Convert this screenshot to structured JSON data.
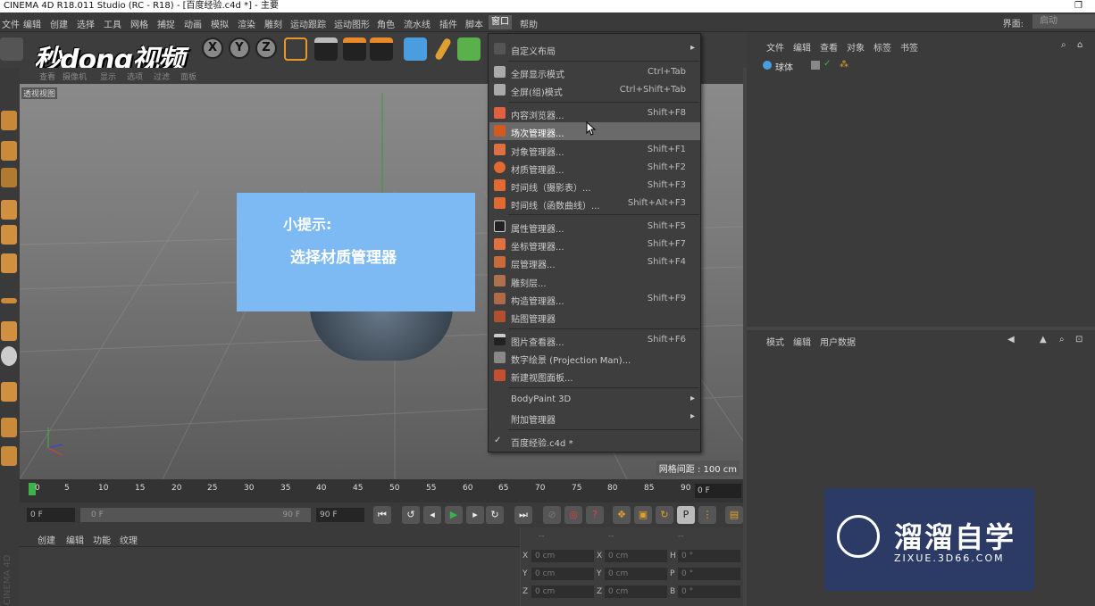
{
  "titlebar": {
    "title": "CINEMA 4D R18.011 Studio (RC - R18) - [百度经验.c4d *] - 主要"
  },
  "menubar": {
    "items": [
      "文件",
      "编辑",
      "创建",
      "选择",
      "工具",
      "网格",
      "捕捉",
      "动画",
      "模拟",
      "渲染",
      "雕刻",
      "运动跟踪",
      "运动图形",
      "角色",
      "流水线",
      "插件",
      "脚本",
      "窗口",
      "帮助"
    ],
    "interface_label": "界面:",
    "interface_value": "启动"
  },
  "watermark": {
    "logo_text": "秒dong视频"
  },
  "toolbar": {
    "axes": [
      "X",
      "Y",
      "Z"
    ]
  },
  "viewport": {
    "menu": [
      "查看",
      "摄像机",
      "显示",
      "选项",
      "过滤",
      "面板"
    ],
    "tag": "透视视图",
    "grid_info": "网格间距 : 100 cm"
  },
  "tip": {
    "line1": "小提示:",
    "line2": "选择材质管理器"
  },
  "timeline": {
    "ticks": [
      "0",
      "5",
      "10",
      "15",
      "20",
      "25",
      "30",
      "35",
      "40",
      "45",
      "50",
      "55",
      "60",
      "65",
      "70",
      "75",
      "80",
      "85",
      "90"
    ],
    "frame": "0 F"
  },
  "controls": {
    "start": "0 F",
    "range_start": "0 F",
    "range_end": "90 F",
    "end": "90 F"
  },
  "material_panel": {
    "menu": [
      "创建",
      "编辑",
      "功能",
      "纹理"
    ]
  },
  "coord_panel": {
    "header": [
      "--",
      "--",
      "--"
    ],
    "rows": [
      {
        "a": "X",
        "av": "0 cm",
        "b": "X",
        "bv": "0 cm",
        "c": "H",
        "cv": "0 °"
      },
      {
        "a": "Y",
        "av": "0 cm",
        "b": "Y",
        "bv": "0 cm",
        "c": "P",
        "cv": "0 °"
      },
      {
        "a": "Z",
        "av": "0 cm",
        "b": "Z",
        "bv": "0 cm",
        "c": "B",
        "cv": "0 °"
      }
    ]
  },
  "object_panel": {
    "menu": [
      "文件",
      "编辑",
      "查看",
      "对象",
      "标签",
      "书签"
    ],
    "object": "球体"
  },
  "attr_panel": {
    "menu": [
      "模式",
      "编辑",
      "用户数据"
    ]
  },
  "dropdown": {
    "items": [
      {
        "label": "自定义布局",
        "shortcut": "",
        "arrow": "▸"
      },
      {
        "label": "全屏显示模式",
        "shortcut": "Ctrl+Tab",
        "arrow": ""
      },
      {
        "label": "全屏(组)模式",
        "shortcut": "Ctrl+Shift+Tab",
        "arrow": ""
      },
      {
        "label": "内容浏览器...",
        "shortcut": "Shift+F8",
        "arrow": ""
      },
      {
        "label": "场次管理器...",
        "shortcut": "",
        "arrow": ""
      },
      {
        "label": "对象管理器...",
        "shortcut": "Shift+F1",
        "arrow": ""
      },
      {
        "label": "材质管理器...",
        "shortcut": "Shift+F2",
        "arrow": ""
      },
      {
        "label": "时间线（摄影表）...",
        "shortcut": "Shift+F3",
        "arrow": ""
      },
      {
        "label": "时间线（函数曲线）...",
        "shortcut": "Shift+Alt+F3",
        "arrow": ""
      },
      {
        "label": "属性管理器...",
        "shortcut": "Shift+F5",
        "arrow": ""
      },
      {
        "label": "坐标管理器...",
        "shortcut": "Shift+F7",
        "arrow": ""
      },
      {
        "label": "层管理器...",
        "shortcut": "Shift+F4",
        "arrow": ""
      },
      {
        "label": "雕刻层...",
        "shortcut": "",
        "arrow": ""
      },
      {
        "label": "构造管理器...",
        "shortcut": "Shift+F9",
        "arrow": ""
      },
      {
        "label": "贴图管理器",
        "shortcut": "",
        "arrow": ""
      },
      {
        "label": "图片查看器...",
        "shortcut": "Shift+F6",
        "arrow": ""
      },
      {
        "label": "数字绘景 (Projection Man)...",
        "shortcut": "",
        "arrow": ""
      },
      {
        "label": "新建视图面板...",
        "shortcut": "",
        "arrow": ""
      },
      {
        "label": "BodyPaint 3D",
        "shortcut": "",
        "arrow": "▸"
      },
      {
        "label": "附加管理器",
        "shortcut": "",
        "arrow": "▸"
      },
      {
        "label": "百度经验.c4d *",
        "shortcut": "",
        "arrow": ""
      }
    ]
  },
  "brand": {
    "name": "溜溜自学",
    "url": "ZIXUE.3D66.COM"
  },
  "side_label": "CINEMA 4D"
}
